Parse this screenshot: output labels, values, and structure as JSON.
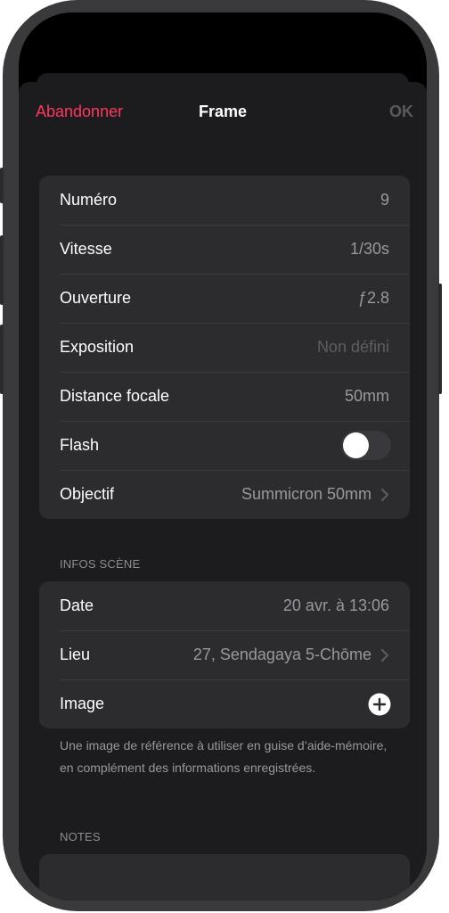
{
  "nav": {
    "cancel_label": "Abandonner",
    "title": "Frame",
    "ok_label": "OK"
  },
  "frame_settings": {
    "rows": [
      {
        "label": "Numéro",
        "value": "9"
      },
      {
        "label": "Vitesse",
        "value": "1/30s"
      },
      {
        "label": "Ouverture",
        "value": "ƒ2.8"
      },
      {
        "label": "Exposition",
        "value": "Non défini"
      },
      {
        "label": "Distance focale",
        "value": "50mm"
      },
      {
        "label": "Flash",
        "toggle_on": false
      },
      {
        "label": "Objectif",
        "value": "Summicron 50mm"
      }
    ]
  },
  "scene_info": {
    "header": "INFOS SCÈNE",
    "rows": [
      {
        "label": "Date",
        "value": "20 avr. à 13:06"
      },
      {
        "label": "Lieu",
        "value": "27, Sendagaya 5-Chōme"
      },
      {
        "label": "Image"
      }
    ],
    "footer": "Une image de référence à utiliser en guise d’aide-mémoire, en complément des informations enregistrées."
  },
  "notes": {
    "header": "NOTES"
  },
  "colors": {
    "accent_cancel": "#ff375f",
    "sheet_background": "#1c1c1e",
    "cell_background": "#2c2c2e",
    "secondary_text": "#98989e"
  },
  "icons": [
    "chevron-right-icon",
    "plus-circle-icon"
  ]
}
